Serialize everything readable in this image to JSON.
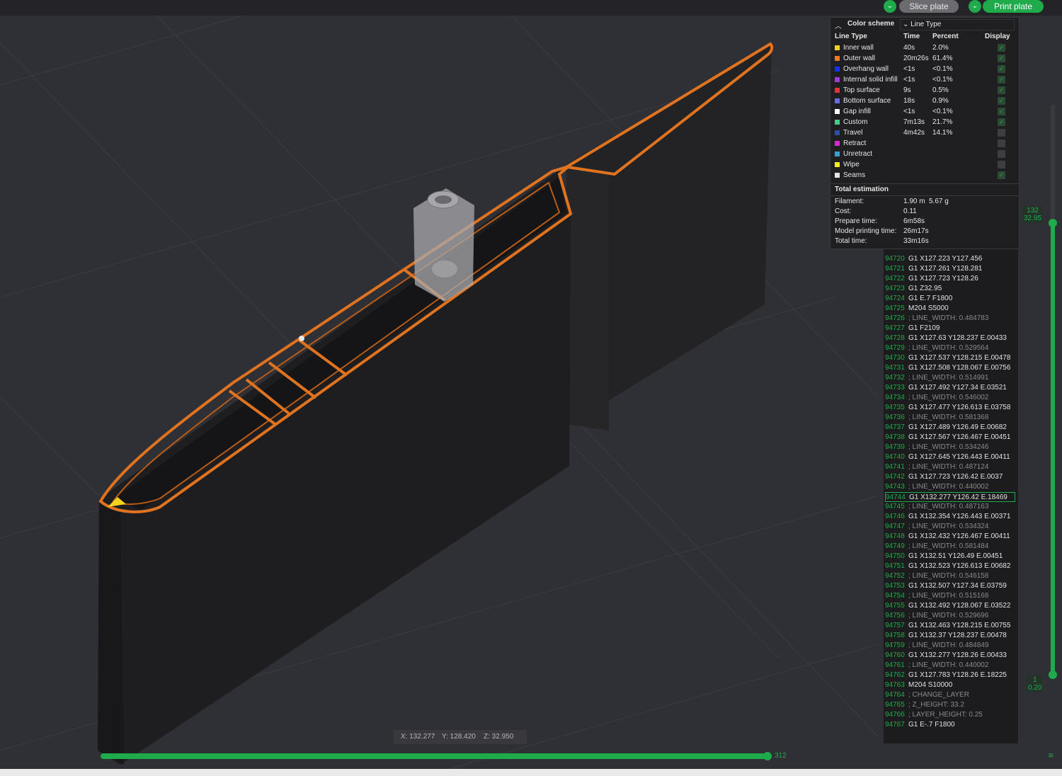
{
  "toolbar": {
    "slice_label": "Slice plate",
    "print_label": "Print plate"
  },
  "legend": {
    "color_scheme_label": "Color scheme",
    "scheme_value": "Line Type",
    "headers": {
      "type": "Line Type",
      "time": "Time",
      "percent": "Percent",
      "display": "Display"
    },
    "rows": [
      {
        "name": "Inner wall",
        "time": "40s",
        "percent": "2.0%",
        "color": "#f2d21e",
        "display": true
      },
      {
        "name": "Outer wall",
        "time": "20m26s",
        "percent": "61.4%",
        "color": "#f07a22",
        "display": true
      },
      {
        "name": "Overhang wall",
        "time": "<1s",
        "percent": "<0.1%",
        "color": "#1a2ef0",
        "display": true
      },
      {
        "name": "Internal solid infill",
        "time": "<1s",
        "percent": "<0.1%",
        "color": "#9a3fd6",
        "display": true
      },
      {
        "name": "Top surface",
        "time": "9s",
        "percent": "0.5%",
        "color": "#e0353d",
        "display": true
      },
      {
        "name": "Bottom surface",
        "time": "18s",
        "percent": "0.9%",
        "color": "#6b6ae0",
        "display": true
      },
      {
        "name": "Gap infill",
        "time": "<1s",
        "percent": "<0.1%",
        "color": "#ffffff",
        "display": true
      },
      {
        "name": "Custom",
        "time": "7m13s",
        "percent": "21.7%",
        "color": "#43cf83",
        "display": true
      },
      {
        "name": "Travel",
        "time": "4m42s",
        "percent": "14.1%",
        "color": "#2c4fa8",
        "display": false
      },
      {
        "name": "Retract",
        "time": "",
        "percent": "",
        "color": "#d62ad6",
        "display": false
      },
      {
        "name": "Unretract",
        "time": "",
        "percent": "",
        "color": "#3aa0c9",
        "display": false
      },
      {
        "name": "Wipe",
        "time": "",
        "percent": "",
        "color": "#f4f20d",
        "display": false
      },
      {
        "name": "Seams",
        "time": "",
        "percent": "",
        "color": "#e4e4e4",
        "display": true
      }
    ],
    "total_estimation_label": "Total estimation",
    "estimation": [
      {
        "label": "Filament:",
        "value": "1.90 m",
        "value2": "5.67 g"
      },
      {
        "label": "Cost:",
        "value": "0.11",
        "value2": ""
      },
      {
        "label": "Prepare time:",
        "value": "6m58s",
        "value2": ""
      },
      {
        "label": "Model printing time:",
        "value": "26m17s",
        "value2": ""
      },
      {
        "label": "Total time:",
        "value": "33m16s",
        "value2": ""
      }
    ]
  },
  "gcode": {
    "lines": [
      {
        "n": "94720",
        "t": "G1 X127.223 Y127.456",
        "c": false
      },
      {
        "n": "94721",
        "t": "G1 X127.261 Y128.281",
        "c": false
      },
      {
        "n": "94722",
        "t": "G1 X127.723 Y128.26",
        "c": false
      },
      {
        "n": "94723",
        "t": "G1 Z32.95",
        "c": false
      },
      {
        "n": "94724",
        "t": "G1 E.7 F1800",
        "c": false
      },
      {
        "n": "94725",
        "t": "M204 S5000",
        "c": false
      },
      {
        "n": "94726",
        "t": "; LINE_WIDTH: 0.484783",
        "c": true
      },
      {
        "n": "94727",
        "t": "G1 F2109",
        "c": false
      },
      {
        "n": "94728",
        "t": "G1 X127.63 Y128.237 E.00433",
        "c": false
      },
      {
        "n": "94729",
        "t": "; LINE_WIDTH: 0.529564",
        "c": true
      },
      {
        "n": "94730",
        "t": "G1 X127.537 Y128.215 E.00478",
        "c": false
      },
      {
        "n": "94731",
        "t": "G1 X127.508 Y128.067 E.00756",
        "c": false
      },
      {
        "n": "94732",
        "t": "; LINE_WIDTH: 0.514991",
        "c": true
      },
      {
        "n": "94733",
        "t": "G1 X127.492 Y127.34 E.03521",
        "c": false
      },
      {
        "n": "94734",
        "t": "; LINE_WIDTH: 0.546002",
        "c": true
      },
      {
        "n": "94735",
        "t": "G1 X127.477 Y126.613 E.03758",
        "c": false
      },
      {
        "n": "94736",
        "t": "; LINE_WIDTH: 0.581368",
        "c": true
      },
      {
        "n": "94737",
        "t": "G1 X127.489 Y126.49 E.00682",
        "c": false
      },
      {
        "n": "94738",
        "t": "G1 X127.567 Y126.467 E.00451",
        "c": false
      },
      {
        "n": "94739",
        "t": "; LINE_WIDTH: 0.534246",
        "c": true
      },
      {
        "n": "94740",
        "t": "G1 X127.645 Y126.443 E.00411",
        "c": false
      },
      {
        "n": "94741",
        "t": "; LINE_WIDTH: 0.487124",
        "c": true
      },
      {
        "n": "94742",
        "t": "G1 X127.723 Y126.42 E.0037",
        "c": false
      },
      {
        "n": "94743",
        "t": "; LINE_WIDTH: 0.440002",
        "c": true
      },
      {
        "n": "94744",
        "t": "G1 X132.277 Y126.42 E.18469",
        "c": false
      },
      {
        "n": "94745",
        "t": "; LINE_WIDTH: 0.487163",
        "c": true
      },
      {
        "n": "94746",
        "t": "G1 X132.354 Y126.443 E.00371",
        "c": false
      },
      {
        "n": "94747",
        "t": "; LINE_WIDTH: 0.534324",
        "c": true
      },
      {
        "n": "94748",
        "t": "G1 X132.432 Y126.467 E.00411",
        "c": false
      },
      {
        "n": "94749",
        "t": "; LINE_WIDTH: 0.581484",
        "c": true
      },
      {
        "n": "94750",
        "t": "G1 X132.51 Y126.49 E.00451",
        "c": false
      },
      {
        "n": "94751",
        "t": "G1 X132.523 Y126.613 E.00682",
        "c": false
      },
      {
        "n": "94752",
        "t": "; LINE_WIDTH: 0.546158",
        "c": true
      },
      {
        "n": "94753",
        "t": "G1 X132.507 Y127.34 E.03759",
        "c": false
      },
      {
        "n": "94754",
        "t": "; LINE_WIDTH: 0.515168",
        "c": true
      },
      {
        "n": "94755",
        "t": "G1 X132.492 Y128.067 E.03522",
        "c": false
      },
      {
        "n": "94756",
        "t": "; LINE_WIDTH: 0.529696",
        "c": true
      },
      {
        "n": "94757",
        "t": "G1 X132.463 Y128.215 E.00755",
        "c": false
      },
      {
        "n": "94758",
        "t": "G1 X132.37 Y128.237 E.00478",
        "c": false
      },
      {
        "n": "94759",
        "t": "; LINE_WIDTH: 0.484849",
        "c": true
      },
      {
        "n": "94760",
        "t": "G1 X132.277 Y128.26 E.00433",
        "c": false
      },
      {
        "n": "94761",
        "t": "; LINE_WIDTH: 0.440002",
        "c": true
      },
      {
        "n": "94762",
        "t": "G1 X127.783 Y128.26 E.18225",
        "c": false
      },
      {
        "n": "94763",
        "t": "M204 S10000",
        "c": false
      },
      {
        "n": "94764",
        "t": "; CHANGE_LAYER",
        "c": true
      },
      {
        "n": "94765",
        "t": "; Z_HEIGHT: 33.2",
        "c": true
      },
      {
        "n": "94766",
        "t": "; LAYER_HEIGHT: 0.25",
        "c": true
      },
      {
        "n": "94767",
        "t": "G1 E-.7 F1800",
        "c": false
      }
    ],
    "selected": "94744"
  },
  "layer_slider": {
    "top_layer": "132",
    "top_height": "32.95",
    "bottom_layer": "1",
    "bottom_height": "0.20"
  },
  "move_slider": {
    "value": "312"
  },
  "coords": {
    "x": "X: 132.277",
    "y": "Y: 128.420",
    "z": "Z: 32.950"
  },
  "colors": {
    "accent": "#1faa4b",
    "outer_wall": "#e0731f",
    "background": "#2f2f36"
  }
}
